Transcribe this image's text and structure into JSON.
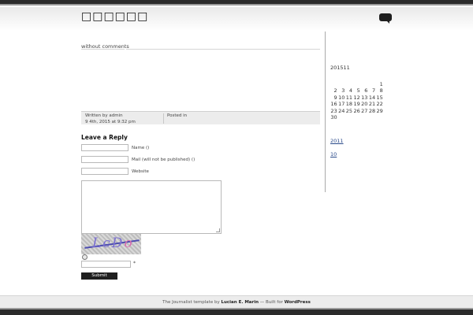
{
  "site": {
    "title": "□□□□□□"
  },
  "post": {
    "comments_status": "without comments",
    "written_by": "Written by admin",
    "date": "9 4th, 2015 at 9:32 pm",
    "posted_in": "Posted in"
  },
  "reply": {
    "heading": "Leave a Reply",
    "name_label": "Name ()",
    "mail_label": "Mail (will not be published) ()",
    "website_label": "Website",
    "captcha_text_1": "LcD",
    "captcha_text_2": "o",
    "required": "*",
    "submit": "Submit Comment"
  },
  "sidebar": {
    "calendar_caption": "201511",
    "calendar_rows": [
      [
        "",
        "",
        "",
        "",
        "",
        "",
        "1"
      ],
      [
        "2",
        "3",
        "4",
        "5",
        "6",
        "7",
        "8"
      ],
      [
        "9",
        "10",
        "11",
        "12",
        "13",
        "14",
        "15"
      ],
      [
        "16",
        "17",
        "18",
        "19",
        "20",
        "21",
        "22"
      ],
      [
        "23",
        "24",
        "25",
        "26",
        "27",
        "28",
        "29"
      ],
      [
        "30",
        "",
        "",
        "",
        "",
        "",
        ""
      ]
    ],
    "archive_link": "2011",
    "category_link": "10"
  },
  "footer": {
    "prefix": "The Journalist template by ",
    "author": "Lucian E. Marin",
    "middle": " — Built for ",
    "platform": "WordPress"
  }
}
